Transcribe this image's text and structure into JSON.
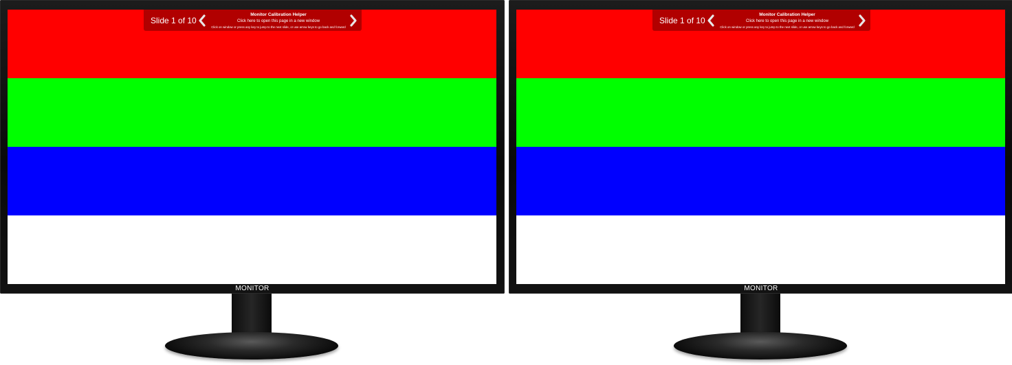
{
  "monitors": [
    {
      "brand_label": "MONITOR",
      "toolbar": {
        "slide_counter": "Slide 1 of 10",
        "title": "Monitor Calibration Helper",
        "open_link": "Click here to open this page in a new window",
        "hint": "Click on window or press any key to jump to the next slide, or use arrow keys to go back and forward",
        "prev_icon": "chevron-left-icon",
        "next_icon": "chevron-right-icon"
      },
      "screen": {
        "bands": [
          "#ff0000",
          "#00ff00",
          "#0000ff",
          "#ffffff"
        ]
      }
    },
    {
      "brand_label": "MONITOR",
      "toolbar": {
        "slide_counter": "Slide 1 of 10",
        "title": "Monitor Calibration Helper",
        "open_link": "Click here to open this page in a new window",
        "hint": "Click on window or press any key to jump to the next slide, or use arrow keys to go back and forward",
        "prev_icon": "chevron-left-icon",
        "next_icon": "chevron-right-icon"
      },
      "screen": {
        "bands": [
          "#ff0000",
          "#00ff00",
          "#0000ff",
          "#ffffff"
        ]
      }
    }
  ]
}
